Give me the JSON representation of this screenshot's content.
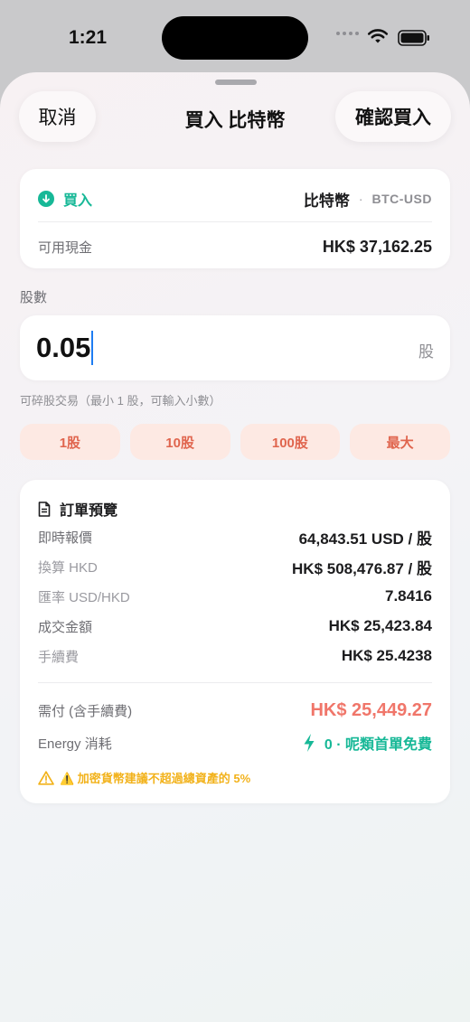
{
  "status_bar": {
    "time": "1:21"
  },
  "header": {
    "cancel_label": "取消",
    "title": "買入 比特幣",
    "confirm_label": "確認買入"
  },
  "order_info": {
    "side_label": "買入",
    "asset_name": "比特幣",
    "separator": "·",
    "ticker": "BTC-USD",
    "cash_label": "可用現金",
    "cash_value": "HK$ 37,162.25"
  },
  "quantity": {
    "section_label": "股數",
    "value": "0.05",
    "unit": "股",
    "hint": "可碎股交易（最小 1 股，可輸入小數）"
  },
  "quick_buttons": [
    "1股",
    "10股",
    "100股",
    "最大"
  ],
  "summary": {
    "title": "訂單預覽",
    "realtime_label": "即時報價",
    "realtime_value": "64,843.51 USD / 股",
    "converted_label": "換算 HKD",
    "converted_value": "HK$ 508,476.87 / 股",
    "rate_label": "匯率 USD/HKD",
    "rate_value": "7.8416",
    "amount_label": "成交金額",
    "amount_value": "HK$ 25,423.84",
    "fee_label": "手續費",
    "fee_value": "HK$ 25.4238",
    "due_label": "需付 (含手續費)",
    "due_value": "HK$ 25,449.27",
    "energy_label": "Energy 消耗",
    "energy_value": "0 · 呢類首單免費",
    "warning": "⚠️ 加密貨幣建議不超過總資產的 5%"
  },
  "colors": {
    "accent_green": "#17b897",
    "accent_red": "#f0766a",
    "quick_button_bg": "#fde9e3",
    "warning": "#f2b21b"
  },
  "icons": [
    "wifi-icon",
    "battery-icon",
    "arrow-down-circle-icon",
    "document-icon",
    "bolt-icon",
    "warning-icon"
  ]
}
